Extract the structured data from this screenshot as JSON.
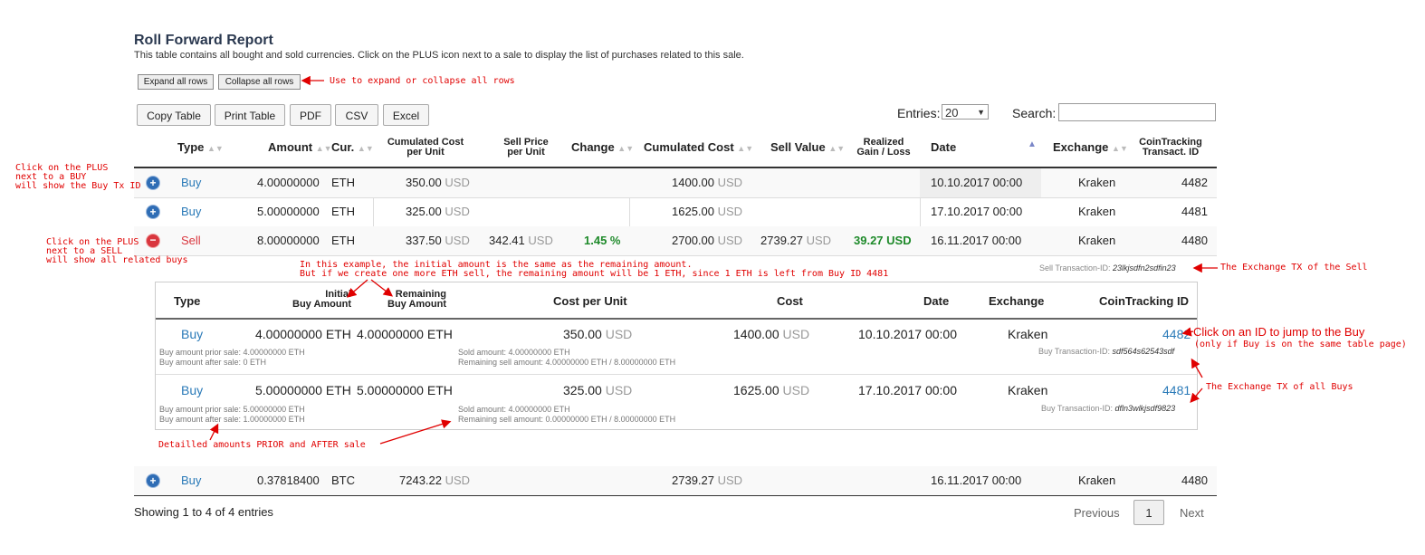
{
  "header": {
    "title": "Roll Forward Report",
    "subtitle": "This table contains all bought and sold currencies. Click on the PLUS icon next to a sale to display the list of purchases related to this sale."
  },
  "row_buttons": {
    "expand": "Expand all rows",
    "collapse": "Collapse all rows"
  },
  "export_buttons": [
    "Copy Table",
    "Print Table",
    "PDF",
    "CSV",
    "Excel"
  ],
  "entries": {
    "label": "Entries:",
    "value": "20"
  },
  "search": {
    "label": "Search:",
    "value": ""
  },
  "columns": {
    "type": "Type",
    "amount": "Amount",
    "cur": "Cur.",
    "cum_cost_unit_1": "Cumulated Cost",
    "cum_cost_unit_2": "per Unit",
    "sell_price_1": "Sell Price",
    "sell_price_2": "per Unit",
    "change": "Change",
    "cum_cost": "Cumulated Cost",
    "sell_value": "Sell Value",
    "realized_1": "Realized",
    "realized_2": "Gain / Loss",
    "date": "Date",
    "exchange": "Exchange",
    "txid_1": "CoinTracking",
    "txid_2": "Transact. ID"
  },
  "rows": [
    {
      "type": "Buy",
      "amount": "4.00000000",
      "cur": "ETH",
      "ccu": "350.00",
      "ccu_cur": "USD",
      "sp": "",
      "sp_cur": "",
      "change": "",
      "cc": "1400.00",
      "cc_cur": "USD",
      "sv": "",
      "sv_cur": "",
      "gain": "",
      "date": "10.10.2017 00:00",
      "exchange": "Kraken",
      "id": "4482"
    },
    {
      "type": "Buy",
      "amount": "5.00000000",
      "cur": "ETH",
      "ccu": "325.00",
      "ccu_cur": "USD",
      "sp": "",
      "sp_cur": "",
      "change": "",
      "cc": "1625.00",
      "cc_cur": "USD",
      "sv": "",
      "sv_cur": "",
      "gain": "",
      "date": "17.10.2017 00:00",
      "exchange": "Kraken",
      "id": "4481"
    },
    {
      "type": "Sell",
      "amount": "8.00000000",
      "cur": "ETH",
      "ccu": "337.50",
      "ccu_cur": "USD",
      "sp": "342.41",
      "sp_cur": "USD",
      "change": "1.45 %",
      "cc": "2700.00",
      "cc_cur": "USD",
      "sv": "2739.27",
      "sv_cur": "USD",
      "gain": "39.27 USD",
      "date": "16.11.2017 00:00",
      "exchange": "Kraken",
      "id": "4480"
    },
    {
      "type": "Buy",
      "amount": "0.37818400",
      "cur": "BTC",
      "ccu": "7243.22",
      "ccu_cur": "USD",
      "sp": "",
      "sp_cur": "",
      "change": "",
      "cc": "2739.27",
      "cc_cur": "USD",
      "sv": "",
      "sv_cur": "",
      "gain": "",
      "date": "16.11.2017 00:00",
      "exchange": "Kraken",
      "id": "4480"
    }
  ],
  "sell_tx": {
    "label": "Sell Transaction-ID:",
    "value": "23lkjsdfn2sdfin23"
  },
  "sub": {
    "columns": {
      "type": "Type",
      "initial_1": "Initial",
      "initial_2": "Buy Amount",
      "remaining_1": "Remaining",
      "remaining_2": "Buy Amount",
      "cpu": "Cost per Unit",
      "cost": "Cost",
      "date": "Date",
      "exchange": "Exchange",
      "id": "CoinTracking ID"
    },
    "rows": [
      {
        "type": "Buy",
        "initial": "4.00000000 ETH",
        "remaining": "4.00000000 ETH",
        "cpu": "350.00",
        "cpu_cur": "USD",
        "cost": "1400.00",
        "cost_cur": "USD",
        "date": "10.10.2017 00:00",
        "exchange": "Kraken",
        "id": "4482",
        "prior": "Buy amount prior sale: 4.00000000 ETH",
        "after": "Buy amount after sale: 0 ETH",
        "sold": "Sold amount: 4.00000000 ETH",
        "remaining_sell": "Remaining sell amount: 4.00000000 ETH / 8.00000000 ETH",
        "tx_label": "Buy Transaction-ID:",
        "tx": "sdf564s62543sdf"
      },
      {
        "type": "Buy",
        "initial": "5.00000000 ETH",
        "remaining": "5.00000000 ETH",
        "cpu": "325.00",
        "cpu_cur": "USD",
        "cost": "1625.00",
        "cost_cur": "USD",
        "date": "17.10.2017 00:00",
        "exchange": "Kraken",
        "id": "4481",
        "prior": "Buy amount prior sale: 5.00000000 ETH",
        "after": "Buy amount after sale: 1.00000000 ETH",
        "sold": "Sold amount: 4.00000000 ETH",
        "remaining_sell": "Remaining sell amount: 0.00000000 ETH / 8.00000000 ETH",
        "tx_label": "Buy Transaction-ID:",
        "tx": "dfln3wlkjsdf9823"
      }
    ]
  },
  "footer": {
    "showing": "Showing 1 to 4 of 4 entries",
    "previous": "Previous",
    "page": "1",
    "next": "Next"
  },
  "annotations": {
    "expand": "Use to expand or collapse all rows",
    "buy_plus": "Click on the PLUS\nnext to a BUY\nwill show the Buy Tx ID",
    "sell_plus": "Click on the PLUS\nnext to a SELL\nwill show all related buys",
    "example": "In this example, the initial amount is the same as the remaining amount.\nBut if we create one more ETH sell, the remaining amount will be 1 ETH, since 1 ETH is left from Buy ID 4481",
    "sell_tx": "The Exchange TX of the Sell",
    "jump_1": "Click on an ID to jump to the Buy",
    "jump_2": "(only if Buy is on the same table page)",
    "buys_tx": "The Exchange TX of all Buys",
    "detail": "Detailled amounts PRIOR and AFTER sale"
  },
  "colors": {
    "link": "#2a7ab8",
    "positive": "#1e8a2a",
    "annotation": "#e00000",
    "plus": "#2f6db5",
    "minus": "#d9363e"
  }
}
